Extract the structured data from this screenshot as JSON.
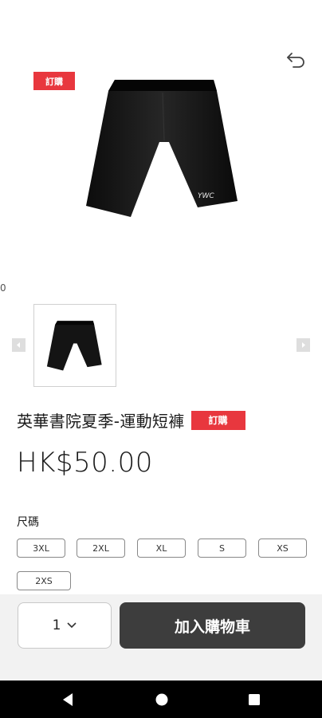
{
  "product": {
    "badge": "訂購",
    "title": "英華書院夏季-運動短褲",
    "price": "HK$50.00",
    "shorts_logo": "YWC"
  },
  "gallery": {
    "index_text": "0"
  },
  "size": {
    "label": "尺碼",
    "options": [
      "3XL",
      "2XL",
      "XL",
      "S",
      "XS",
      "2XS"
    ]
  },
  "cart": {
    "quantity": "1",
    "add_to_cart_label": "加入購物車"
  },
  "colors": {
    "badge": "#e8373e",
    "button": "#3d3d3d"
  },
  "icons": [
    "back-icon",
    "chevron-left-icon",
    "chevron-right-icon",
    "chevron-down-icon",
    "nav-back-icon",
    "nav-home-icon",
    "nav-recents-icon"
  ]
}
